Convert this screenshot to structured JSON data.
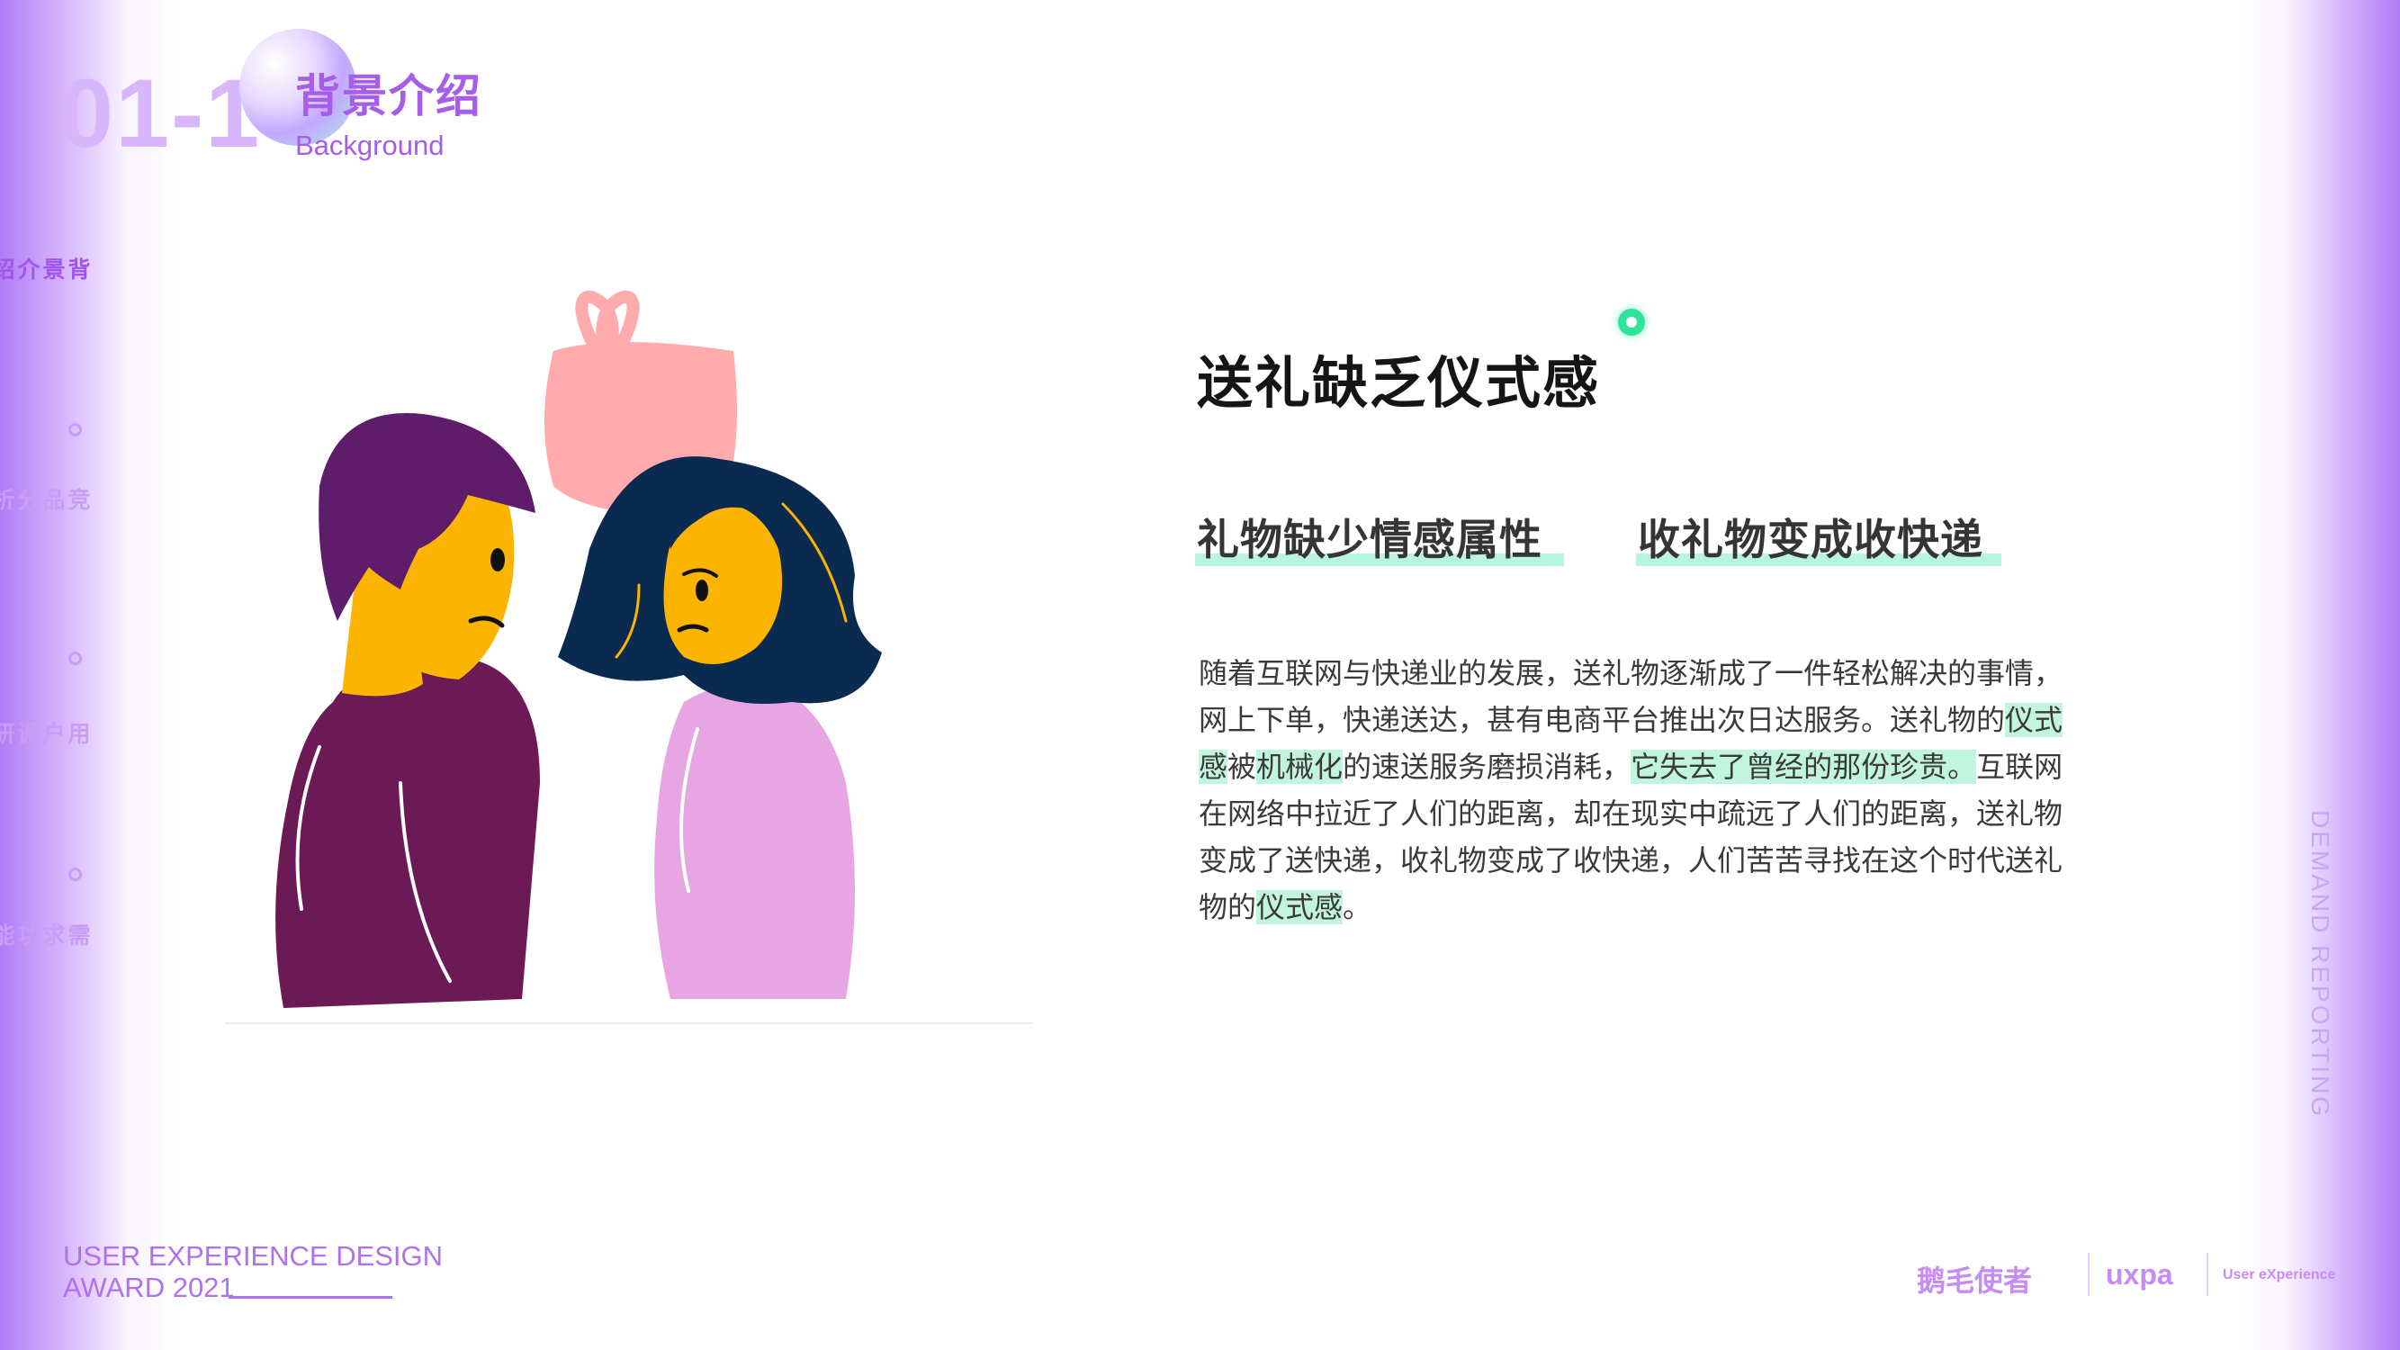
{
  "header": {
    "section_number": "01-1",
    "title": "背景介绍",
    "subtitle": "Background"
  },
  "sidebar": {
    "items": [
      {
        "label": "背景介绍",
        "active": true
      },
      {
        "label": "竞品分析",
        "active": false
      },
      {
        "label": "用户调研",
        "active": false
      },
      {
        "label": "需求功能提炼",
        "active": false
      }
    ]
  },
  "right_vertical_text": "DEMAND REPORTING",
  "main": {
    "headline": "送礼缺乏仪式感",
    "tags": [
      "礼物缺少情感属性",
      "收礼物变成收快递"
    ],
    "paragraph": {
      "p1": "随着互联网与快递业的发展，送礼物逐渐成了一件轻松解决的事情，网上下单，快递送达，甚有电商平台推出次日达服务。送礼物的",
      "h1": "仪式感",
      "p2": "被",
      "h2": "机械化",
      "p3": "的速送服务磨损消耗，",
      "h3": "它失去了曾经的那份珍贵。",
      "p4": "互联网在网络中拉近了人们的距离，却在现实中疏远了人们的距离，送礼物变成了送快递，收礼物变成了收快递，人们苦苦寻找在这个时代送礼物的",
      "h4": "仪式感",
      "p5": "。"
    },
    "highlight_color": "#c2f5df"
  },
  "footer": {
    "award_line1": "USER EXPERIENCE DESIGN",
    "award_line2": "AWARD 2021",
    "logos": [
      "鹅毛使者",
      "uxpa",
      "User eXperience"
    ]
  },
  "illustration": {
    "description_icons": [
      "gift-icon",
      "man-figure",
      "woman-figure"
    ],
    "colors": {
      "gift": "#ffabad",
      "man_hair": "#5e1c6a",
      "man_shirt": "#6b1a55",
      "skin": "#fbb500",
      "woman_hair": "#0b2a50",
      "woman_dress": "#e7a6e3"
    }
  }
}
